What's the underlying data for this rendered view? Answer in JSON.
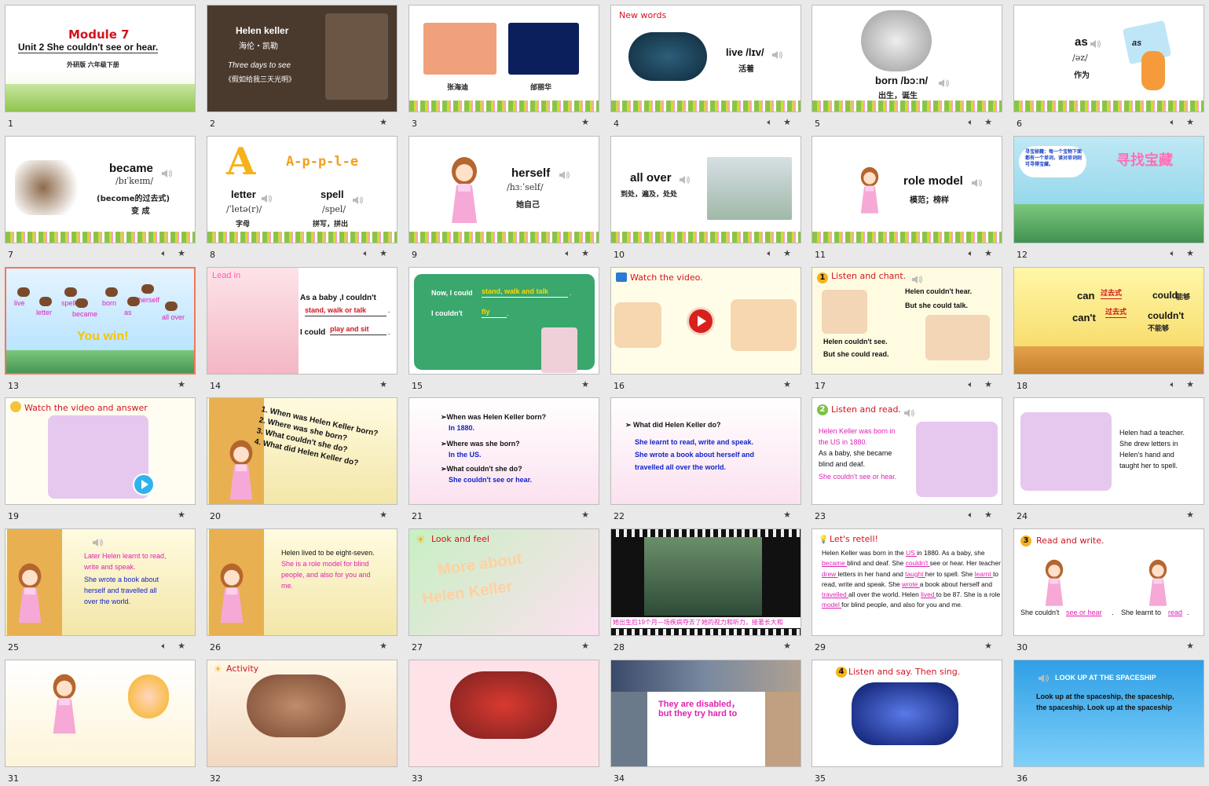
{
  "slides": [
    {
      "num": "1",
      "lines": [
        "Module    7",
        "Unit 2    She couldn't see or hear.",
        "外研版    六年级下册"
      ],
      "icons": []
    },
    {
      "num": "2",
      "lines": [
        "Helen keller",
        "海伦・凯勒",
        "Three days to see",
        "《假如给我三天光明》"
      ],
      "icons": [
        "star"
      ]
    },
    {
      "num": "3",
      "lines": [
        "张海迪",
        "邰丽华"
      ],
      "icons": [
        "star"
      ]
    },
    {
      "num": "4",
      "lines": [
        "New words",
        "live /lɪv/",
        "活着"
      ],
      "icons": [
        "speaker",
        "star"
      ]
    },
    {
      "num": "5",
      "lines": [
        "born /bɔːn/",
        "出生，诞生"
      ],
      "icons": [
        "speaker",
        "star"
      ]
    },
    {
      "num": "6",
      "lines": [
        "as",
        "/əz/",
        "作为",
        "as"
      ],
      "icons": [
        "speaker",
        "star"
      ]
    },
    {
      "num": "7",
      "lines": [
        "became",
        "/bɪˈkeɪm/",
        "(become的过去式)",
        "变  成"
      ],
      "icons": [
        "speaker",
        "star"
      ]
    },
    {
      "num": "8",
      "lines": [
        "A-p-p-l-e",
        "letter",
        "/ˈletə(r)/",
        "字母",
        "spell",
        "/spel/",
        "拼写，拼出"
      ],
      "icons": [
        "speaker",
        "star"
      ]
    },
    {
      "num": "9",
      "lines": [
        "herself",
        "/hɜːˈself/",
        "她自己"
      ],
      "icons": [
        "speaker",
        "star"
      ]
    },
    {
      "num": "10",
      "lines": [
        "all over",
        "到处，遍及，处处"
      ],
      "icons": [
        "speaker",
        "star"
      ]
    },
    {
      "num": "11",
      "lines": [
        "role model",
        "模范；榜样"
      ],
      "icons": [
        "speaker",
        "star"
      ]
    },
    {
      "num": "12",
      "lines": [
        "寻宝秘籍：每一个宝物下面都有一个单词，读对单词则可寻得宝藏。",
        "寻找宝藏"
      ],
      "icons": [
        "speaker",
        "star"
      ]
    },
    {
      "num": "13",
      "lines": [
        "live",
        "spell",
        "born",
        "herself",
        "letter",
        "became",
        "as",
        "all over",
        "You win!"
      ],
      "icons": [
        "star"
      ]
    },
    {
      "num": "14",
      "lines": [
        "Lead in",
        "As a baby ,I couldn't",
        "stand, walk or talk",
        ".",
        "I could",
        "play and sit",
        "."
      ],
      "icons": [
        "star"
      ]
    },
    {
      "num": "15",
      "lines": [
        "Now, I could",
        "stand, walk and talk",
        ".",
        "I couldn't",
        "fly",
        "."
      ],
      "icons": [
        "star"
      ]
    },
    {
      "num": "16",
      "lines": [
        "Watch the video."
      ],
      "icons": [
        "star"
      ]
    },
    {
      "num": "17",
      "lines": [
        "Listen and chant.",
        "Helen couldn't hear.",
        "But she could talk.",
        "Helen couldn't see.",
        "But she could read."
      ],
      "icons": [
        "speaker",
        "star"
      ]
    },
    {
      "num": "18",
      "lines": [
        "can",
        "过去式",
        "could",
        "能够",
        "can't",
        "过去式",
        "couldn't",
        "不能够"
      ],
      "icons": [
        "speaker",
        "star"
      ]
    },
    {
      "num": "19",
      "lines": [
        "Watch the video and answer"
      ],
      "icons": [
        "star"
      ]
    },
    {
      "num": "20",
      "lines": [
        "1. When was Helen Keller born?",
        "2. Where was she born?",
        "3. What couldn't she do?",
        "4. What did Helen Keller do?"
      ],
      "icons": [
        "star"
      ]
    },
    {
      "num": "21",
      "lines": [
        "➢When was Helen Keller born?",
        "In 1880.",
        "➢Where was she born?",
        "In the US.",
        "➢What couldn't she do?",
        "She couldn't see or hear."
      ],
      "icons": [
        "star"
      ]
    },
    {
      "num": "22",
      "lines": [
        "➢ What did Helen Keller do?",
        "She learnt to read, write and speak.",
        "She wrote a book about herself and",
        "travelled all over the world."
      ],
      "icons": [
        "star"
      ]
    },
    {
      "num": "23",
      "lines": [
        "Listen and read.",
        "Helen Keller was born in",
        "the US in 1880.",
        "As a baby, she became",
        "blind and deaf.",
        "She couldn't see or hear."
      ],
      "icons": [
        "speaker",
        "star"
      ]
    },
    {
      "num": "24",
      "lines": [
        "Helen had a teacher.",
        "She drew letters in",
        "Helen's hand and",
        "taught her to spell."
      ],
      "icons": [
        "star"
      ]
    },
    {
      "num": "25",
      "lines": [
        "Later Helen learnt to read,",
        "write and speak.",
        "She wrote a book about",
        "herself and travelled all",
        "over the world."
      ],
      "icons": [
        "speaker",
        "star"
      ]
    },
    {
      "num": "26",
      "lines": [
        "Helen lived to be eight-seven.",
        "She is a role model for blind",
        "people, and also for you and",
        "me."
      ],
      "icons": [
        "star"
      ]
    },
    {
      "num": "27",
      "lines": [
        "Look and feel",
        "More about",
        "Helen Keller"
      ],
      "icons": [
        "star"
      ]
    },
    {
      "num": "28",
      "lines": [
        "她出生后19个月—场疾病夺去了她的视力和听力，接著长大和"
      ],
      "icons": [
        "star"
      ]
    },
    {
      "num": "29",
      "lines": [
        "Let's retell!",
        "Helen Keller was born in the",
        "US",
        "in 1880. As a",
        "baby, she",
        "became",
        "blind and deaf. She",
        "couldn't",
        "see or hear. Her teacher",
        "drew",
        "letters in her hand",
        "and",
        "taught",
        "her to spell. She",
        "learnt",
        "to read, write",
        "and speak. She",
        "wrote",
        "a book about herself and",
        "travelled",
        "all over the world. Helen",
        "lived",
        "to be 87.",
        "She is a role",
        "model",
        "for blind people, and also for",
        "you and me."
      ],
      "icons": [
        "star"
      ]
    },
    {
      "num": "30",
      "lines": [
        "Read and write.",
        "She couldn't",
        "see or hear",
        ".",
        "She learnt to",
        "read",
        "."
      ],
      "icons": [
        "star"
      ]
    },
    {
      "num": "31",
      "lines": [],
      "icons": []
    },
    {
      "num": "32",
      "lines": [
        "Activity"
      ],
      "icons": []
    },
    {
      "num": "33",
      "lines": [],
      "icons": []
    },
    {
      "num": "34",
      "lines": [
        "They are disabled，",
        "but  they try hard to"
      ],
      "icons": []
    },
    {
      "num": "35",
      "lines": [
        "Listen and say. Then sing."
      ],
      "icons": []
    },
    {
      "num": "36",
      "lines": [
        "LOOK UP AT THE SPACESHIP",
        "Look up at the spaceship, the spaceship,",
        "the spaceship. Look up at the spaceship"
      ],
      "icons": []
    }
  ],
  "colors": {
    "accent": "#d2141e",
    "blue": "#1224c8",
    "pink": "#e021b4",
    "selected_border": "#f0785a"
  }
}
